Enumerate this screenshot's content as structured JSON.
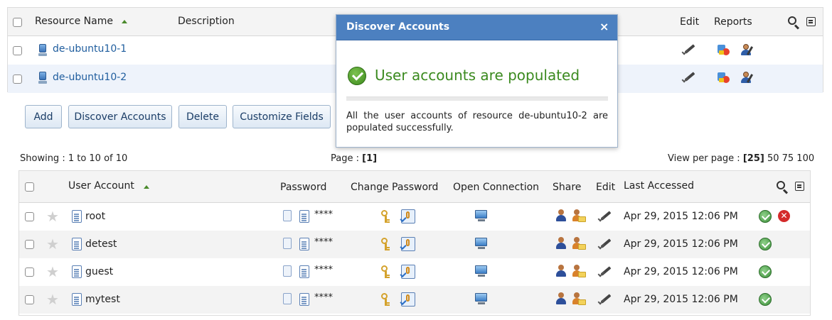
{
  "resources": {
    "columns": {
      "name": "Resource Name",
      "description": "Description",
      "edit": "Edit",
      "reports": "Reports"
    },
    "rows": [
      {
        "name": "de-ubuntu10-1"
      },
      {
        "name": "de-ubuntu10-2"
      }
    ]
  },
  "actions": {
    "add": "Add",
    "discover": "Discover Accounts",
    "delete": "Delete",
    "customize": "Customize Fields"
  },
  "pager": {
    "showing": "Showing : 1 to 10 of 10",
    "page_label": "Page : ",
    "page_value": "[1]",
    "view_label": "View per page : ",
    "view_current": "[25]",
    "view_options": "50 75 100"
  },
  "accounts": {
    "columns": {
      "user_account": "User Account",
      "password": "Password",
      "change_password": "Change Password",
      "open_connection": "Open Connection",
      "share": "Share",
      "edit": "Edit",
      "last_accessed": "Last Accessed"
    },
    "rows": [
      {
        "name": "root",
        "password": "****",
        "last_accessed": "Apr 29, 2015 12:06 PM"
      },
      {
        "name": "detest",
        "password": "****",
        "last_accessed": "Apr 29, 2015 12:06 PM"
      },
      {
        "name": "guest",
        "password": "****",
        "last_accessed": "Apr 29, 2015 12:06 PM"
      },
      {
        "name": "mytest",
        "password": "****",
        "last_accessed": "Apr 29, 2015 12:06 PM"
      }
    ]
  },
  "modal": {
    "title": "Discover Accounts",
    "close": "×",
    "status": "User accounts are populated",
    "message": "All the user accounts of resource de-ubuntu10-2 are populated successfully."
  },
  "colors": {
    "link": "#1f5d9e",
    "modal_header": "#4c80c0",
    "success": "#3b8a1f",
    "button_border": "#9eb4cc"
  }
}
